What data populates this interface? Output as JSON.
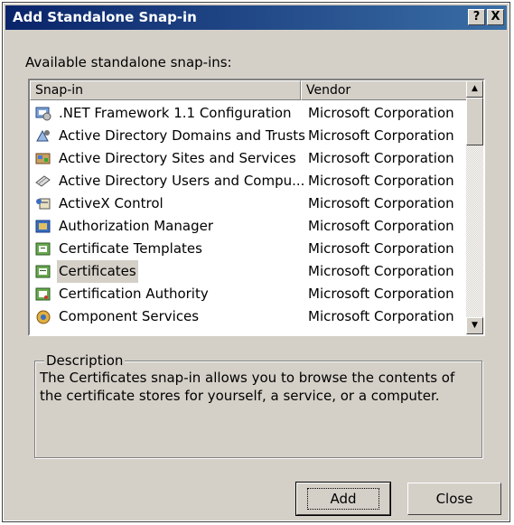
{
  "window": {
    "title": "Add Standalone Snap-in",
    "help_label": "?",
    "close_label": "X"
  },
  "available_label": "Available standalone snap-ins:",
  "columns": {
    "snapin": "Snap-in",
    "vendor": "Vendor"
  },
  "rows": [
    {
      "name": ".NET Framework 1.1 Configuration",
      "vendor": "Microsoft Corporation",
      "icon": "net-config-icon",
      "selected": false
    },
    {
      "name": "Active Directory Domains and Trusts",
      "vendor": "Microsoft Corporation",
      "icon": "ad-domains-icon",
      "selected": false
    },
    {
      "name": "Active Directory Sites and Services",
      "vendor": "Microsoft Corporation",
      "icon": "ad-sites-icon",
      "selected": false
    },
    {
      "name": "Active Directory Users and Compu...",
      "vendor": "Microsoft Corporation",
      "icon": "ad-users-icon",
      "selected": false
    },
    {
      "name": "ActiveX Control",
      "vendor": "Microsoft Corporation",
      "icon": "activex-icon",
      "selected": false
    },
    {
      "name": "Authorization Manager",
      "vendor": "Microsoft Corporation",
      "icon": "authorization-icon",
      "selected": false
    },
    {
      "name": "Certificate Templates",
      "vendor": "Microsoft Corporation",
      "icon": "certificate-templates-icon",
      "selected": false
    },
    {
      "name": "Certificates",
      "vendor": "Microsoft Corporation",
      "icon": "certificates-icon",
      "selected": true
    },
    {
      "name": "Certification Authority",
      "vendor": "Microsoft Corporation",
      "icon": "certification-authority-icon",
      "selected": false
    },
    {
      "name": "Component Services",
      "vendor": "Microsoft Corporation",
      "icon": "component-services-icon",
      "selected": false
    }
  ],
  "description": {
    "label": "Description",
    "text": "The Certificates snap-in allows you to browse the contents of the certificate stores for yourself, a service, or a computer."
  },
  "buttons": {
    "add": "Add",
    "close": "Close"
  }
}
